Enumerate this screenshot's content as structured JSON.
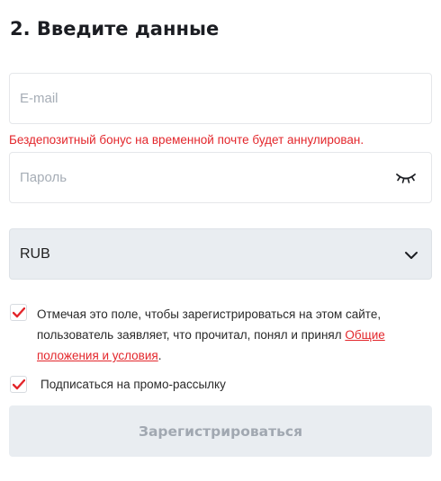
{
  "form": {
    "title": "2. Введите данные",
    "email": {
      "placeholder": "E-mail",
      "value": ""
    },
    "email_warning": "Бездепозитный бонус на временной почте будет аннулирован.",
    "password": {
      "placeholder": "Пароль",
      "value": "",
      "toggle_icon": "eye-closed-icon"
    },
    "currency": {
      "selected": "RUB",
      "icon": "chevron-down-icon"
    },
    "terms": {
      "checked": true,
      "text": "Отмечая это поле, чтобы зарегистрироваться на этом сайте, пользователь заявляет, что прочитал, понял и принял ",
      "link": "Общие положения и условия",
      "suffix": "."
    },
    "promo": {
      "checked": true,
      "label": "Подписаться на промо-рассылку"
    },
    "submit_label": "Зарегистрироваться"
  },
  "colors": {
    "accent_red": "#e3262b",
    "select_bg": "#e9edf1",
    "disabled_text": "#a1a8b1"
  }
}
